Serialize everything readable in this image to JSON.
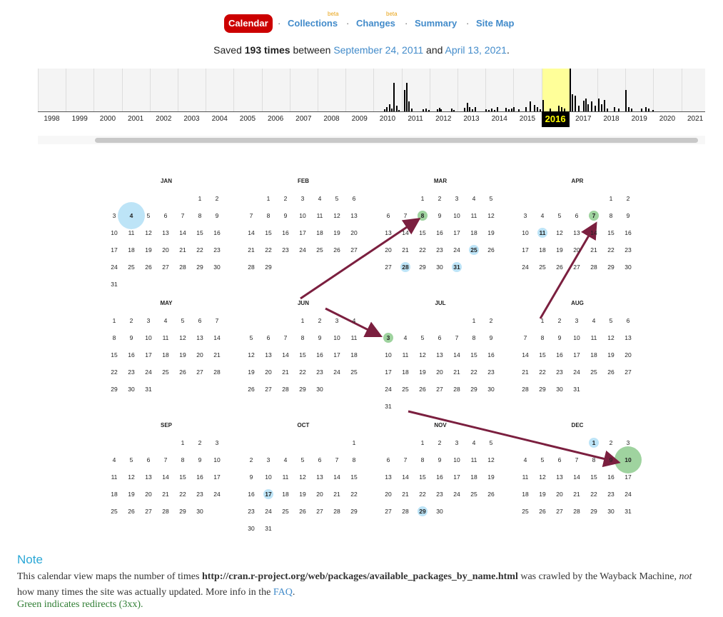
{
  "nav": {
    "calendar": "Calendar",
    "collections": "Collections",
    "changes": "Changes",
    "summary": "Summary",
    "sitemap": "Site Map",
    "beta": "beta",
    "separator": "·"
  },
  "saved": {
    "prefix": "Saved",
    "count": "193 times",
    "between": "between",
    "start": "September 24, 2011",
    "and": "and",
    "end": "April 13, 2021",
    "period": "."
  },
  "timeline": {
    "years": [
      "1998",
      "1999",
      "2000",
      "2001",
      "2002",
      "2003",
      "2004",
      "2005",
      "2006",
      "2007",
      "2008",
      "2009",
      "2010",
      "2011",
      "2012",
      "2013",
      "2014",
      "2015",
      "2016",
      "2017",
      "2018",
      "2019",
      "2020",
      "2021"
    ],
    "selected_year": "2016",
    "highlight_color": "#ffff99"
  },
  "calendar": {
    "months": [
      {
        "name": "JAN",
        "offset": 5,
        "days": 31,
        "snapshots": [
          {
            "day": 4,
            "color": "blue",
            "size": "large"
          }
        ]
      },
      {
        "name": "FEB",
        "offset": 1,
        "days": 29,
        "snapshots": []
      },
      {
        "name": "MAR",
        "offset": 2,
        "days": 31,
        "snapshots": [
          {
            "day": 8,
            "color": "green",
            "size": "small"
          },
          {
            "day": 25,
            "color": "blue",
            "size": "small"
          },
          {
            "day": 28,
            "color": "blue",
            "size": "small"
          },
          {
            "day": 31,
            "color": "blue",
            "size": "small"
          }
        ]
      },
      {
        "name": "APR",
        "offset": 5,
        "days": 30,
        "snapshots": [
          {
            "day": 7,
            "color": "green",
            "size": "small"
          },
          {
            "day": 11,
            "color": "blue",
            "size": "small"
          }
        ]
      },
      {
        "name": "MAY",
        "offset": 0,
        "days": 31,
        "snapshots": []
      },
      {
        "name": "JUN",
        "offset": 3,
        "days": 30,
        "snapshots": []
      },
      {
        "name": "JUL",
        "offset": 5,
        "days": 31,
        "snapshots": [
          {
            "day": 3,
            "color": "green",
            "size": "small"
          }
        ]
      },
      {
        "name": "AUG",
        "offset": 1,
        "days": 31,
        "snapshots": []
      },
      {
        "name": "SEP",
        "offset": 4,
        "days": 30,
        "snapshots": []
      },
      {
        "name": "OCT",
        "offset": 6,
        "days": 31,
        "snapshots": [
          {
            "day": 17,
            "color": "blue",
            "size": "small"
          }
        ]
      },
      {
        "name": "NOV",
        "offset": 2,
        "days": 30,
        "snapshots": [
          {
            "day": 29,
            "color": "blue",
            "size": "small"
          }
        ]
      },
      {
        "name": "DEC",
        "offset": 4,
        "days": 31,
        "snapshots": [
          {
            "day": 1,
            "color": "blue",
            "size": "small"
          },
          {
            "day": 10,
            "color": "green",
            "size": "large"
          }
        ]
      }
    ]
  },
  "colors": {
    "accent_blue": "#428bca",
    "active_red": "#cc0000",
    "snapshot_blue": "#bde4f7",
    "snapshot_green": "#9fd39f",
    "arrow": "#7b1f3f"
  },
  "note": {
    "title": "Note",
    "text1": "This calendar view maps the number of times",
    "url": "http://cran.r-project.org/web/packages/available_packages_by_name.html",
    "text2": "was crawled by the Wayback Machine,",
    "not": "not",
    "text3": "how many times the site was actually updated. More info in the",
    "faq": "FAQ",
    "period": ".",
    "green": "Green indicates redirects (3xx)."
  }
}
